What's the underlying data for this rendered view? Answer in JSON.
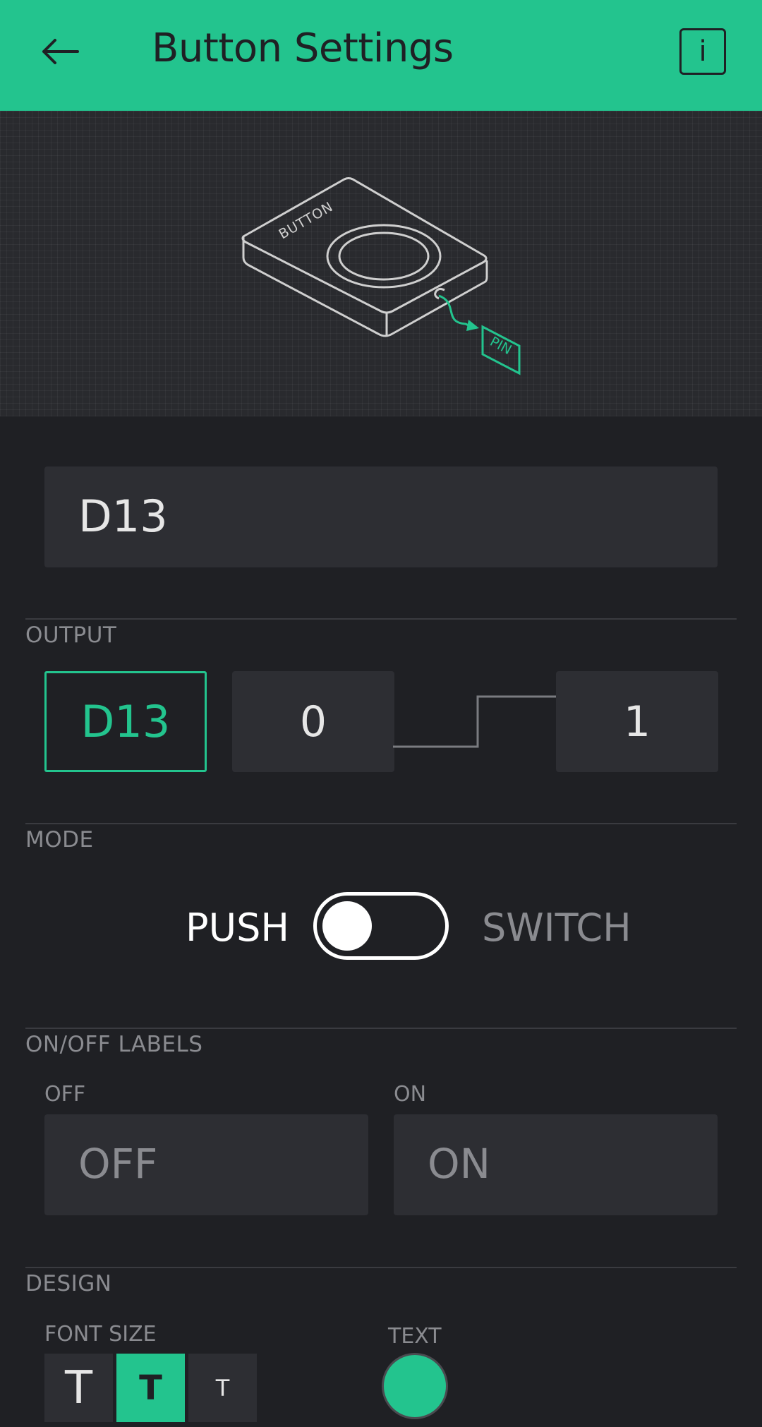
{
  "header": {
    "title": "Button Settings",
    "back_icon": "arrow-left-icon",
    "info_label": "i",
    "color": "#23c48e"
  },
  "illustration": {
    "device_label": "BUTTON",
    "pin_label": "PIN"
  },
  "pin": {
    "value": "D13"
  },
  "output": {
    "section_label": "OUTPUT",
    "pin": "D13",
    "min": "0",
    "max": "1"
  },
  "mode": {
    "section_label": "MODE",
    "left_option": "PUSH",
    "right_option": "SWITCH",
    "selected": "PUSH"
  },
  "labels": {
    "section_label": "ON/OFF LABELS",
    "off_caption": "OFF",
    "on_caption": "ON",
    "off_placeholder": "OFF",
    "on_placeholder": "ON"
  },
  "design": {
    "section_label": "DESIGN",
    "font_size_label": "FONT SIZE",
    "text_label": "TEXT",
    "font_sizes": [
      "T",
      "T",
      "T"
    ],
    "selected_font_size": 1,
    "text_color": "#23c48e"
  }
}
